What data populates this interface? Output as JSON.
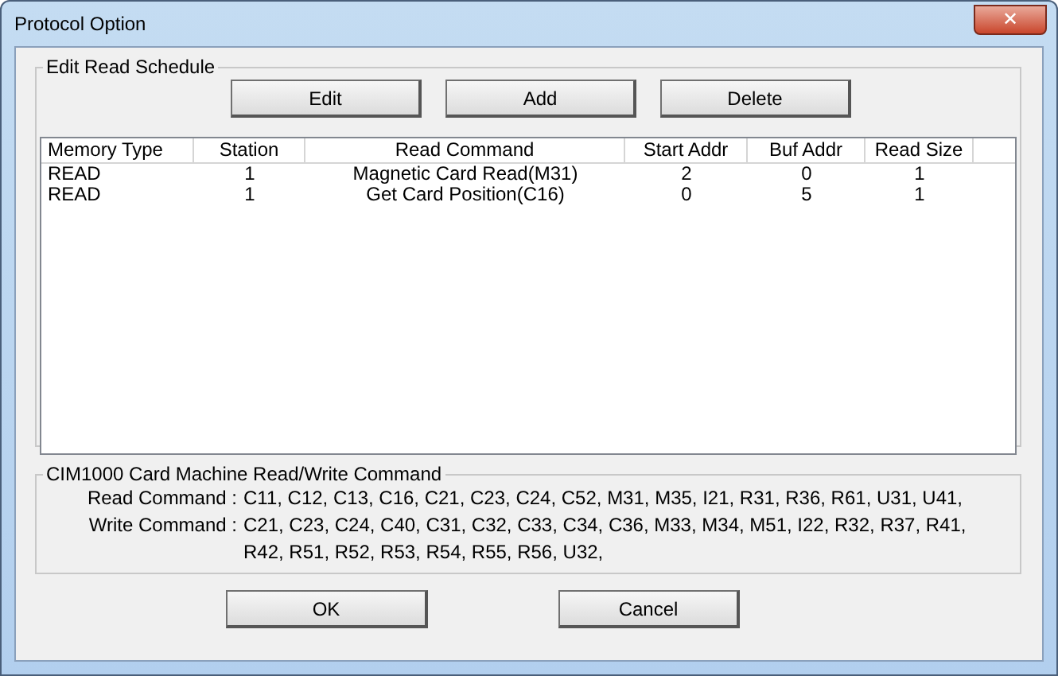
{
  "window": {
    "title": "Protocol Option",
    "close": "✕"
  },
  "schedule": {
    "title": "Edit Read Schedule",
    "buttons": [
      "Edit",
      "Add",
      "Delete"
    ],
    "columns": [
      "Memory Type",
      "Station",
      "Read Command",
      "Start Addr",
      "Buf Addr",
      "Read Size"
    ],
    "rows": [
      [
        "READ",
        "1",
        "Magnetic Card Read(M31)",
        "2",
        "0",
        "1"
      ],
      [
        "READ",
        "1",
        "Get Card Position(C16)",
        "0",
        "5",
        "1"
      ]
    ]
  },
  "commands": {
    "title": "CIM1000 Card Machine Read/Write Command",
    "items": [
      {
        "label": "Read Command :",
        "value": "C11, C12, C13, C16, C21, C23, C24, C52, M31, M35, I21, R31, R36, R61, U31, U41,"
      },
      {
        "label": "Write Command :",
        "value": "C21, C23, C24, C40, C31, C32, C33, C34, C36, M33, M34, M51, I22, R32, R37, R41, R42, R51, R52, R53, R54, R55, R56, U32,"
      }
    ]
  },
  "buttons": [
    "OK",
    "Cancel"
  ]
}
